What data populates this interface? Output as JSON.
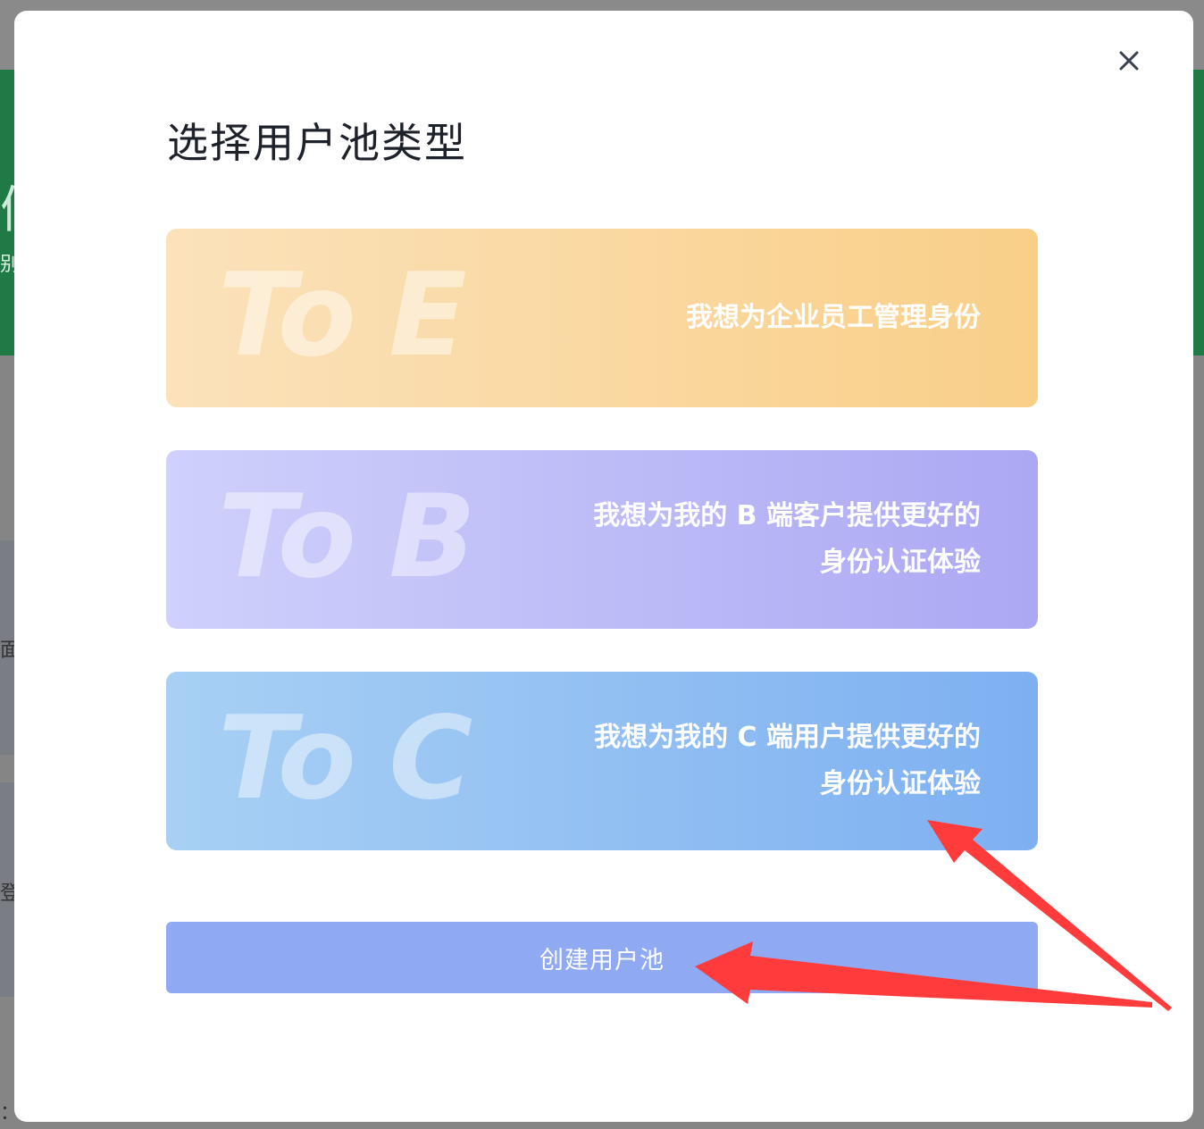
{
  "background": {
    "glyph_1": "们",
    "glyph_2": "别",
    "glyph_3": "面",
    "glyph_4": "登",
    "glyph_5": "："
  },
  "modal": {
    "title": "选择用户池类型",
    "close_icon": "close-icon",
    "cards": [
      {
        "watermark": "To E",
        "line1": "我想为企业员工管理身份",
        "line2": ""
      },
      {
        "watermark": "To B",
        "line1": "我想为我的 B 端客户提供更好的",
        "line2": "身份认证体验"
      },
      {
        "watermark": "To C",
        "line1": "我想为我的 C 端用户提供更好的",
        "line2": "身份认证体验"
      }
    ],
    "create_button": "创建用户池"
  },
  "colors": {
    "to_e": "#f9cf88",
    "to_b": "#aca8f3",
    "to_c": "#7eb0f1",
    "button": "#8faaf3",
    "annotation_arrow": "#ff3b3b"
  }
}
